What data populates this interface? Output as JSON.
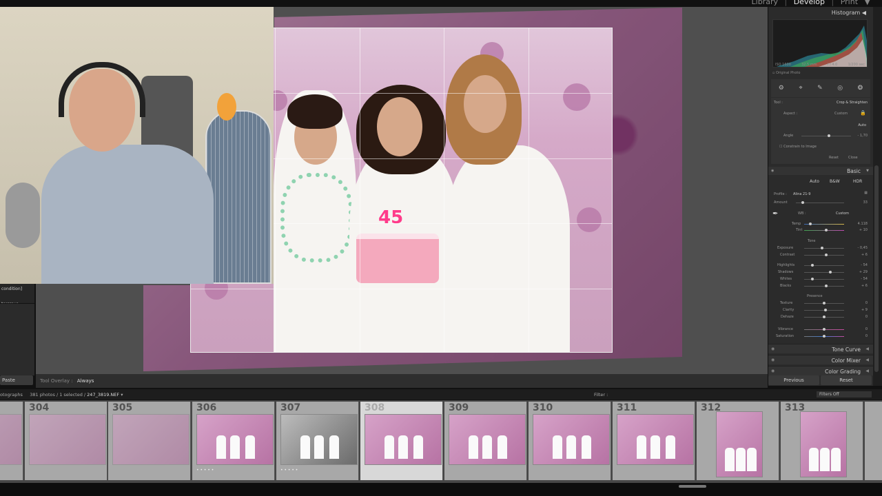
{
  "modules": {
    "library": "Library",
    "develop": "Develop",
    "print": "Print",
    "sep": "|"
  },
  "left_panel": {
    "frag1": "condition]",
    "frag2": "tercrave",
    "paste": "Paste"
  },
  "tool_overlay": {
    "label": "Tool Overlay :",
    "value": "Always"
  },
  "right_panel": {
    "histogram_title": "Histogram",
    "histo_info": [
      "ISO 1600",
      "32.5 mm",
      "f / 4.0",
      "1/200 sec"
    ],
    "original_photo": "Original Photo",
    "tool_icons": [
      "⚙",
      "⌖",
      "✎",
      "◎",
      "❂"
    ],
    "crop": {
      "tool_label": "Tool :",
      "tool_value": "Crop & Straighten",
      "aspect_label": "Aspect :",
      "aspect_value": "Custom",
      "auto": "Auto",
      "angle_label": "Angle",
      "angle_value": "- 1,70",
      "constrain": "Constrain to Image",
      "reset": "Reset",
      "close": "Close"
    },
    "basic_title": "Basic",
    "basic_buttons": [
      "Auto",
      "B&W",
      "HDR"
    ],
    "profile_label": "Profile :",
    "profile_value": "Alina 21-9",
    "amount_label": "Amount",
    "amount_value": "33",
    "wb_label": "WB :",
    "wb_value": "Custom",
    "temp_label": "Temp",
    "temp_value": "4.118",
    "tint_label": "Tint",
    "tint_value": "+ 10",
    "tone_label": "Tone",
    "tone_rows": [
      {
        "label": "Exposure",
        "value": "- 0,45"
      },
      {
        "label": "Contrast",
        "value": "+ 6"
      },
      {
        "label": "Highlights",
        "value": "- 54"
      },
      {
        "label": "Shadows",
        "value": "+ 29"
      },
      {
        "label": "Whites",
        "value": "- 54"
      },
      {
        "label": "Blacks",
        "value": "+ 6"
      }
    ],
    "presence_label": "Presence",
    "presence_rows": [
      {
        "label": "Texture",
        "value": "0"
      },
      {
        "label": "Clarity",
        "value": "+ 9"
      },
      {
        "label": "Dehaze",
        "value": "0"
      },
      {
        "label": "Vibrance",
        "value": "0"
      },
      {
        "label": "Saturation",
        "value": "0"
      }
    ],
    "sections": [
      "Tone Curve",
      "Color Mixer",
      "Color Grading"
    ],
    "previous": "Previous",
    "reset": "Reset"
  },
  "filmbar": {
    "prefix": "otographs",
    "count": "381 photos / 1 selected /",
    "file": "247_3819.NEF",
    "caret": "▾",
    "filter": "Filter :",
    "filters_off": "Filters Off"
  },
  "filmstrip": [
    "",
    "304",
    "305",
    "306",
    "307",
    "308",
    "309",
    "310",
    "311",
    "312",
    "313",
    ""
  ],
  "colors": {
    "accent": "#e6e6e6",
    "panel": "#2b2b2b",
    "workspace": "#4f4f4f",
    "selected": "#d8d8d8"
  }
}
